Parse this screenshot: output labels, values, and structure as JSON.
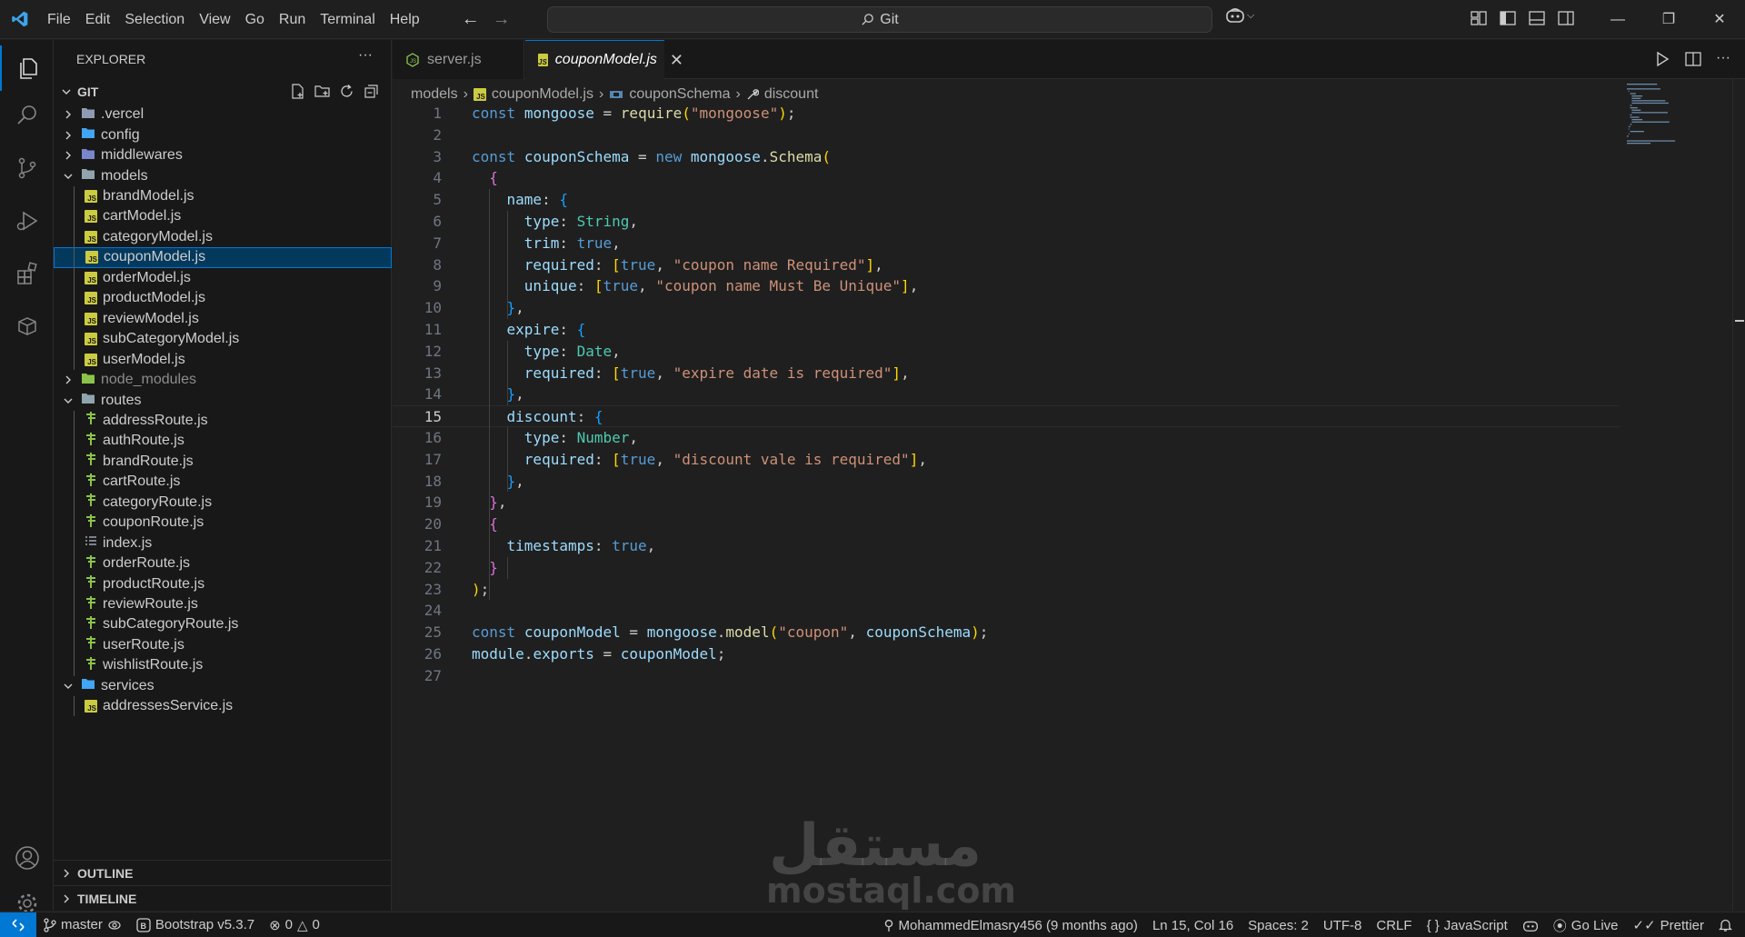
{
  "menu": [
    "File",
    "Edit",
    "Selection",
    "View",
    "Go",
    "Run",
    "Terminal",
    "Help"
  ],
  "command_center": {
    "label": "Git"
  },
  "sidebar": {
    "title": "EXPLORER",
    "root_folder": "GIT",
    "tree": [
      {
        "label": ".vercel",
        "type": "folder",
        "expanded": false,
        "depth": 1
      },
      {
        "label": "config",
        "type": "folder",
        "expanded": false,
        "depth": 1
      },
      {
        "label": "middlewares",
        "type": "folder",
        "expanded": false,
        "depth": 1
      },
      {
        "label": "models",
        "type": "folder",
        "expanded": true,
        "depth": 1
      },
      {
        "label": "brandModel.js",
        "type": "js",
        "depth": 2
      },
      {
        "label": "cartModel.js",
        "type": "js",
        "depth": 2
      },
      {
        "label": "categoryModel.js",
        "type": "js",
        "depth": 2
      },
      {
        "label": "couponModel.js",
        "type": "js",
        "depth": 2,
        "selected": true
      },
      {
        "label": "orderModel.js",
        "type": "js",
        "depth": 2
      },
      {
        "label": "productModel.js",
        "type": "js",
        "depth": 2
      },
      {
        "label": "reviewModel.js",
        "type": "js",
        "depth": 2
      },
      {
        "label": "subCategoryModel.js",
        "type": "js",
        "depth": 2
      },
      {
        "label": "userModel.js",
        "type": "js",
        "depth": 2
      },
      {
        "label": "node_modules",
        "type": "folder",
        "expanded": false,
        "depth": 1,
        "dim": true
      },
      {
        "label": "routes",
        "type": "folder",
        "expanded": true,
        "depth": 1
      },
      {
        "label": "addressRoute.js",
        "type": "route",
        "depth": 2
      },
      {
        "label": "authRoute.js",
        "type": "route",
        "depth": 2
      },
      {
        "label": "brandRoute.js",
        "type": "route",
        "depth": 2
      },
      {
        "label": "cartRoute.js",
        "type": "route",
        "depth": 2
      },
      {
        "label": "categoryRoute.js",
        "type": "route",
        "depth": 2
      },
      {
        "label": "couponRoute.js",
        "type": "route",
        "depth": 2
      },
      {
        "label": "index.js",
        "type": "index",
        "depth": 2
      },
      {
        "label": "orderRoute.js",
        "type": "route",
        "depth": 2
      },
      {
        "label": "productRoute.js",
        "type": "route",
        "depth": 2
      },
      {
        "label": "reviewRoute.js",
        "type": "route",
        "depth": 2
      },
      {
        "label": "subCategoryRoute.js",
        "type": "route",
        "depth": 2
      },
      {
        "label": "userRoute.js",
        "type": "route",
        "depth": 2
      },
      {
        "label": "wishlistRoute.js",
        "type": "route",
        "depth": 2
      },
      {
        "label": "services",
        "type": "folder",
        "expanded": true,
        "depth": 1
      },
      {
        "label": "addressesService.js",
        "type": "js",
        "depth": 2
      }
    ],
    "outline_label": "OUTLINE",
    "timeline_label": "TIMELINE"
  },
  "tabs": [
    {
      "label": "server.js",
      "active": false
    },
    {
      "label": "couponModel.js",
      "active": true
    }
  ],
  "breadcrumb": [
    "models",
    "couponModel.js",
    "couponSchema",
    "discount"
  ],
  "code_lines": [
    "const mongoose = require(\"mongoose\");",
    "",
    "const couponSchema = new mongoose.Schema(",
    "  {",
    "    name: {",
    "      type: String,",
    "      trim: true,",
    "      required: [true, \"coupon name Required\"],",
    "      unique: [true, \"coupon name Must Be Unique\"],",
    "    },",
    "    expire: {",
    "      type: Date,",
    "      required: [true, \"expire date is required\"],",
    "    },",
    "    discount: {",
    "      type: Number,",
    "      required: [true, \"discount vale is required\"],",
    "    },",
    "  },",
    "  {",
    "    timestamps: true,",
    "  }",
    ");",
    "",
    "const couponModel = mongoose.model(\"coupon\", couponSchema);",
    "module.exports = couponModel;",
    ""
  ],
  "current_line": 15,
  "watermark": {
    "arabic": "مستقل",
    "latin": "mostaql.com"
  },
  "statusbar": {
    "branch": "master",
    "bootstrap": "Bootstrap v5.3.7",
    "errors": "0",
    "warnings": "0",
    "blame": "MohammedElmasry456 (9 months ago)",
    "cursor": "Ln 15, Col 16",
    "spaces": "Spaces: 2",
    "encoding": "UTF-8",
    "eol": "CRLF",
    "language": "JavaScript",
    "go_live": "Go Live",
    "prettier": "Prettier"
  },
  "colors": {
    "accent": "#0078d4",
    "js_icon": "#cbcb41",
    "route_icon": "#8bc34a"
  }
}
